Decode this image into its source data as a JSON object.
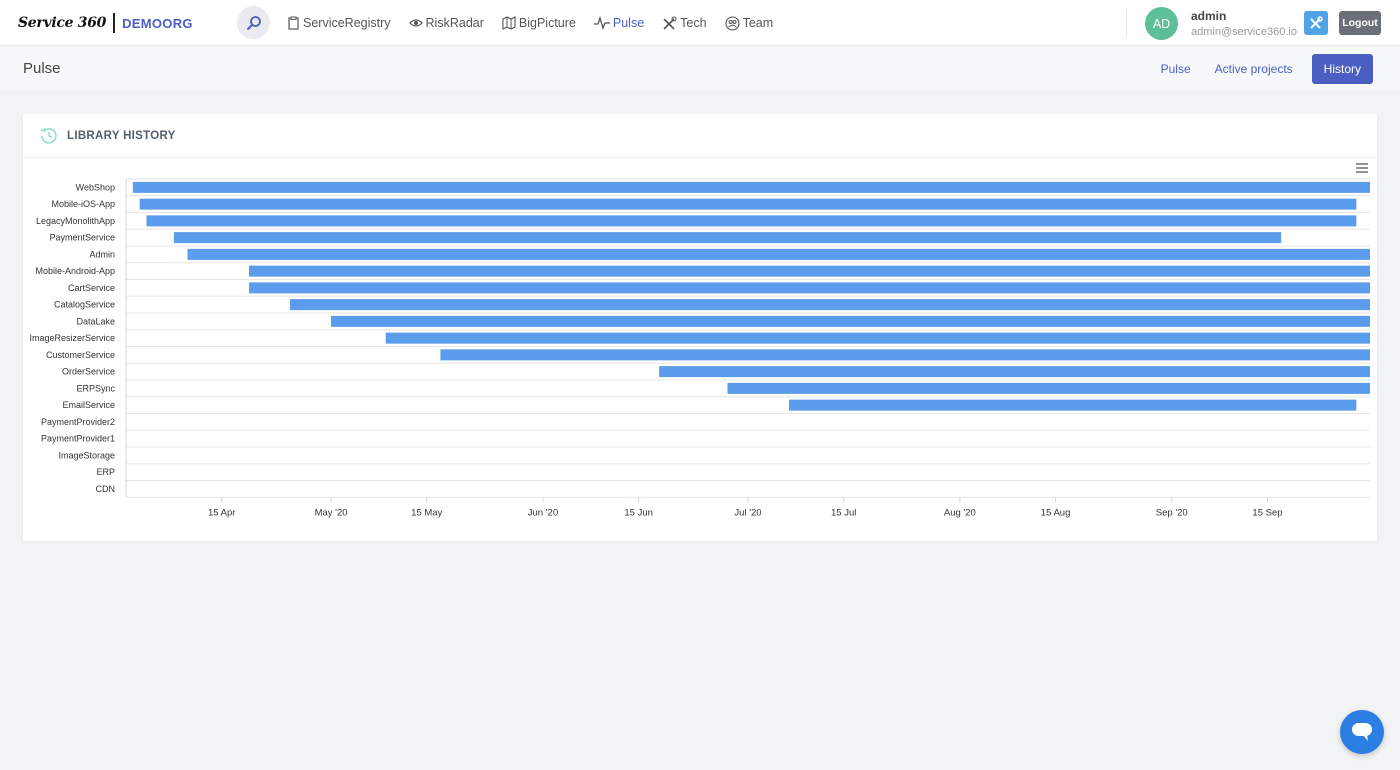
{
  "brand": {
    "logo": "Service 360",
    "org": "DEMOORG"
  },
  "nav": {
    "items": [
      {
        "label": "ServiceRegistry",
        "icon": "clipboard-icon"
      },
      {
        "label": "RiskRadar",
        "icon": "eye-icon"
      },
      {
        "label": "BigPicture",
        "icon": "map-icon"
      },
      {
        "label": "Pulse",
        "icon": "pulse-icon",
        "active": true
      },
      {
        "label": "Tech",
        "icon": "tools-icon"
      },
      {
        "label": "Team",
        "icon": "team-icon"
      }
    ]
  },
  "user": {
    "initials": "AD",
    "name": "admin",
    "email": "admin@service360.io",
    "logout_label": "Logout"
  },
  "page": {
    "title": "Pulse"
  },
  "subnav": {
    "items": [
      {
        "label": "Pulse"
      },
      {
        "label": "Active projects"
      },
      {
        "label": "History",
        "active": true
      }
    ]
  },
  "card": {
    "title": "LIBRARY HISTORY"
  },
  "colors": {
    "accent": "#4a5fc1",
    "bar": "#5b9cec",
    "avatar": "#5dbf97"
  },
  "chart_data": {
    "type": "bar",
    "orientation": "horizontal-timeline",
    "x_axis": {
      "type": "datetime",
      "range": [
        "2020-04-01",
        "2020-09-30"
      ],
      "ticks": [
        "15 Apr",
        "May '20",
        "15 May",
        "Jun '20",
        "15 Jun",
        "Jul '20",
        "15 Jul",
        "Aug '20",
        "15 Aug",
        "Sep '20",
        "15 Sep"
      ]
    },
    "series": [
      {
        "values": [
          {
            "category": "WebShop",
            "start": "2020-04-02",
            "end": "2020-09-30"
          },
          {
            "category": "Mobile-iOS-App",
            "start": "2020-04-03",
            "end": "2020-09-28"
          },
          {
            "category": "LegacyMonolithApp",
            "start": "2020-04-04",
            "end": "2020-09-28"
          },
          {
            "category": "PaymentService",
            "start": "2020-04-08",
            "end": "2020-09-17"
          },
          {
            "category": "Admin",
            "start": "2020-04-10",
            "end": "2020-09-30"
          },
          {
            "category": "Mobile-Android-App",
            "start": "2020-04-19",
            "end": "2020-09-30"
          },
          {
            "category": "CartService",
            "start": "2020-04-19",
            "end": "2020-09-30"
          },
          {
            "category": "CatalogService",
            "start": "2020-04-25",
            "end": "2020-09-30"
          },
          {
            "category": "DataLake",
            "start": "2020-05-01",
            "end": "2020-09-30"
          },
          {
            "category": "ImageResizerService",
            "start": "2020-05-09",
            "end": "2020-09-30"
          },
          {
            "category": "CustomerService",
            "start": "2020-05-17",
            "end": "2020-09-30"
          },
          {
            "category": "OrderService",
            "start": "2020-06-18",
            "end": "2020-09-30"
          },
          {
            "category": "ERPSync",
            "start": "2020-06-28",
            "end": "2020-09-30"
          },
          {
            "category": "EmailService",
            "start": "2020-07-07",
            "end": "2020-09-28"
          },
          {
            "category": "PaymentProvider2",
            "start": null,
            "end": null
          },
          {
            "category": "PaymentProvider1",
            "start": null,
            "end": null
          },
          {
            "category": "ImageStorage",
            "start": null,
            "end": null
          },
          {
            "category": "ERP",
            "start": null,
            "end": null
          },
          {
            "category": "CDN",
            "start": null,
            "end": null
          }
        ]
      }
    ],
    "grid": true,
    "legend": "none"
  }
}
